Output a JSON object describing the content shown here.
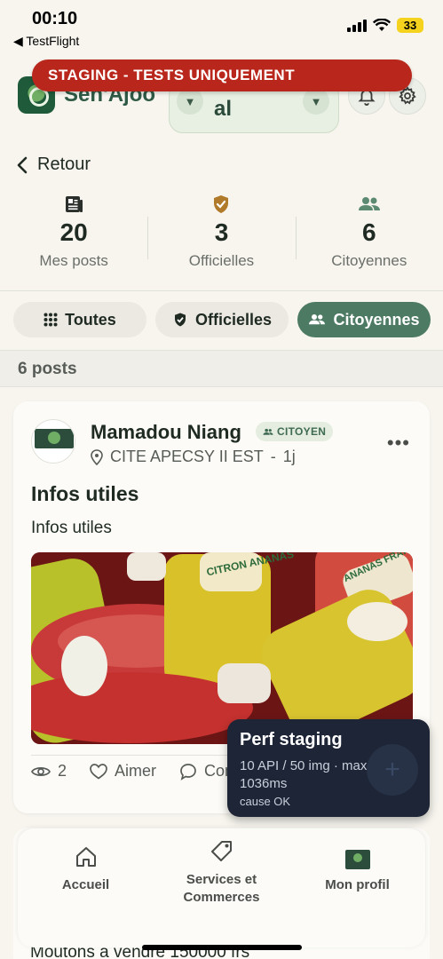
{
  "status_bar": {
    "time": "00:10",
    "back_app": "◀ TestFlight",
    "battery": "33"
  },
  "header": {
    "app_name": "Sen'Ajoo",
    "location_text": "al",
    "staging_banner": "STAGING - TESTS UNIQUEMENT"
  },
  "nav_back": {
    "label": "Retour"
  },
  "stats": [
    {
      "value": "20",
      "label": "Mes posts",
      "icon": "newspaper-icon"
    },
    {
      "value": "3",
      "label": "Officielles",
      "icon": "verified-shield-icon"
    },
    {
      "value": "6",
      "label": "Citoyennes",
      "icon": "people-icon"
    }
  ],
  "filters": [
    {
      "label": "Toutes",
      "icon": "grid-icon",
      "active": false
    },
    {
      "label": "Officielles",
      "icon": "shield-check-icon",
      "active": false
    },
    {
      "label": "Citoyennes",
      "icon": "people-icon",
      "active": true
    }
  ],
  "posts_count": "6 posts",
  "post": {
    "author": "Mamadou Niang",
    "badge": "CITOYEN",
    "location": "CITE APECSY II EST",
    "separator": "-",
    "age": "1j",
    "title": "Infos utiles",
    "body": "Infos utiles",
    "image_labels": {
      "left": "CITRON ANANAS",
      "right": "ANANAS FRAISE"
    },
    "views": "2",
    "like_label": "Aimer",
    "comment_label": "Commenter"
  },
  "perf_toast": {
    "title": "Perf staging",
    "detail": "10 API / 50 img · max 1036ms",
    "cause": "cause OK"
  },
  "bottom_nav": [
    {
      "label": "Accueil",
      "icon": "home-icon"
    },
    {
      "label": "Services et\nCommerces",
      "icon": "tag-icon"
    },
    {
      "label": "Mon profil",
      "icon": "profile-thumbnail"
    }
  ],
  "next_post_title": "Moutons à vendre 150000 frs",
  "colors": {
    "brand_green": "#4d7a63",
    "staging_red": "#b9261b",
    "background": "#f7f5ee",
    "toast_bg": "#1d2536",
    "official_badge": "#b07a2a"
  }
}
